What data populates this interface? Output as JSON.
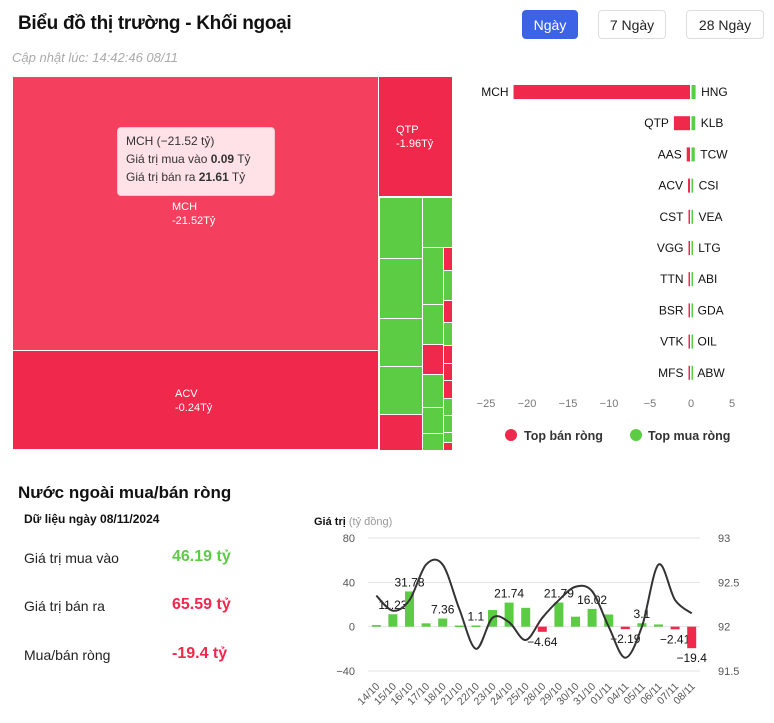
{
  "header": {
    "title": "Biểu đồ thị trường - Khối ngoại",
    "updated": "Cập nhật lúc: 14:42:46 08/11",
    "tabs": [
      {
        "label": "Ngày",
        "active": true
      },
      {
        "label": "7 Ngày",
        "active": false
      },
      {
        "label": "28 Ngày",
        "active": false
      }
    ]
  },
  "colors": {
    "sell": "#f0284c",
    "buy": "#5ccc45",
    "accent": "#3c63e6"
  },
  "treemap": {
    "items": [
      {
        "label": "MCH",
        "value": "-21.52Tỷ"
      },
      {
        "label": "ACV",
        "value": "-0.24Tỷ"
      },
      {
        "label": "QTP",
        "value": "-1.96Tỷ"
      }
    ],
    "tooltip": {
      "title": "MCH (−21.52 tỷ)",
      "buy_label": "Giá trị mua vào",
      "buy_value": "0.09",
      "sell_label": "Giá trị bán ra",
      "sell_value": "21.61",
      "unit": "Tỷ"
    }
  },
  "chart_data": [
    {
      "type": "bar",
      "orientation": "horizontal",
      "xlim": [
        -25,
        5
      ],
      "xticks": [
        -25,
        -20,
        -15,
        -10,
        -5,
        0,
        5
      ],
      "sell": {
        "name": "Top bán ròng",
        "labels": [
          "MCH",
          "QTP",
          "AAS",
          "ACV",
          "CST",
          "VGG",
          "TTN",
          "BSR",
          "VTK",
          "MFS"
        ],
        "values": [
          -21.52,
          -1.96,
          -0.4,
          -0.24,
          -0.1,
          -0.08,
          -0.07,
          -0.06,
          -0.05,
          -0.04
        ]
      },
      "buy": {
        "name": "Top mua ròng",
        "labels": [
          "HNG",
          "KLB",
          "TCW",
          "CSI",
          "VEA",
          "LTG",
          "ABI",
          "GDA",
          "OIL",
          "ABW"
        ],
        "values": [
          0.5,
          0.45,
          0.4,
          0.2,
          0.18,
          0.15,
          0.12,
          0.08,
          0.06,
          0.05
        ]
      },
      "legend": "bottom"
    },
    {
      "type": "bar+line",
      "ylabel": "Giá trị",
      "yunit": "(tỷ đồng)",
      "ylim": [
        -40,
        80
      ],
      "yticks": [
        -40,
        0,
        40,
        80
      ],
      "y2lim": [
        91.5,
        93
      ],
      "y2ticks": [
        91.5,
        92,
        92.5,
        93
      ],
      "grid": true,
      "categories": [
        "14/10",
        "15/10",
        "16/10",
        "17/10",
        "18/10",
        "21/10",
        "22/10",
        "23/10",
        "24/10",
        "25/10",
        "28/10",
        "29/10",
        "30/10",
        "31/10",
        "01/11",
        "04/11",
        "05/11",
        "06/11",
        "07/11",
        "08/11"
      ],
      "values": [
        1.5,
        11.23,
        31.78,
        3,
        7.36,
        1,
        1.1,
        15,
        21.74,
        17,
        -4.64,
        21.79,
        9,
        16.02,
        11,
        -2.19,
        3.1,
        2,
        -2.41,
        -19.4
      ],
      "labels": [
        "",
        "11.23",
        "31.78",
        "",
        "7.36",
        "",
        "1.1",
        "",
        "21.74",
        "",
        "-4.64",
        "21.79",
        "",
        "16.02",
        "",
        "-2.19",
        "3.1",
        "",
        "-2.41",
        "-19.4"
      ],
      "line": [
        92.35,
        92.18,
        92.3,
        92.7,
        92.7,
        92.2,
        91.75,
        92.1,
        92.05,
        91.85,
        92.1,
        92.3,
        92.45,
        92.4,
        92.0,
        91.65,
        92.0,
        92.7,
        92.3,
        92.15
      ]
    }
  ],
  "summary": {
    "title": "Nước ngoài mua/bán ròng",
    "date": "Dữ liệu ngày 08/11/2024",
    "rows": [
      {
        "label": "Giá trị mua vào",
        "value": "46.19 tỷ",
        "color": "#5ccc45"
      },
      {
        "label": "Giá trị bán ra",
        "value": "65.59 tỷ",
        "color": "#f0284c"
      },
      {
        "label": "Mua/bán ròng",
        "value": "-19.4 tỷ",
        "color": "#f0284c"
      }
    ]
  }
}
